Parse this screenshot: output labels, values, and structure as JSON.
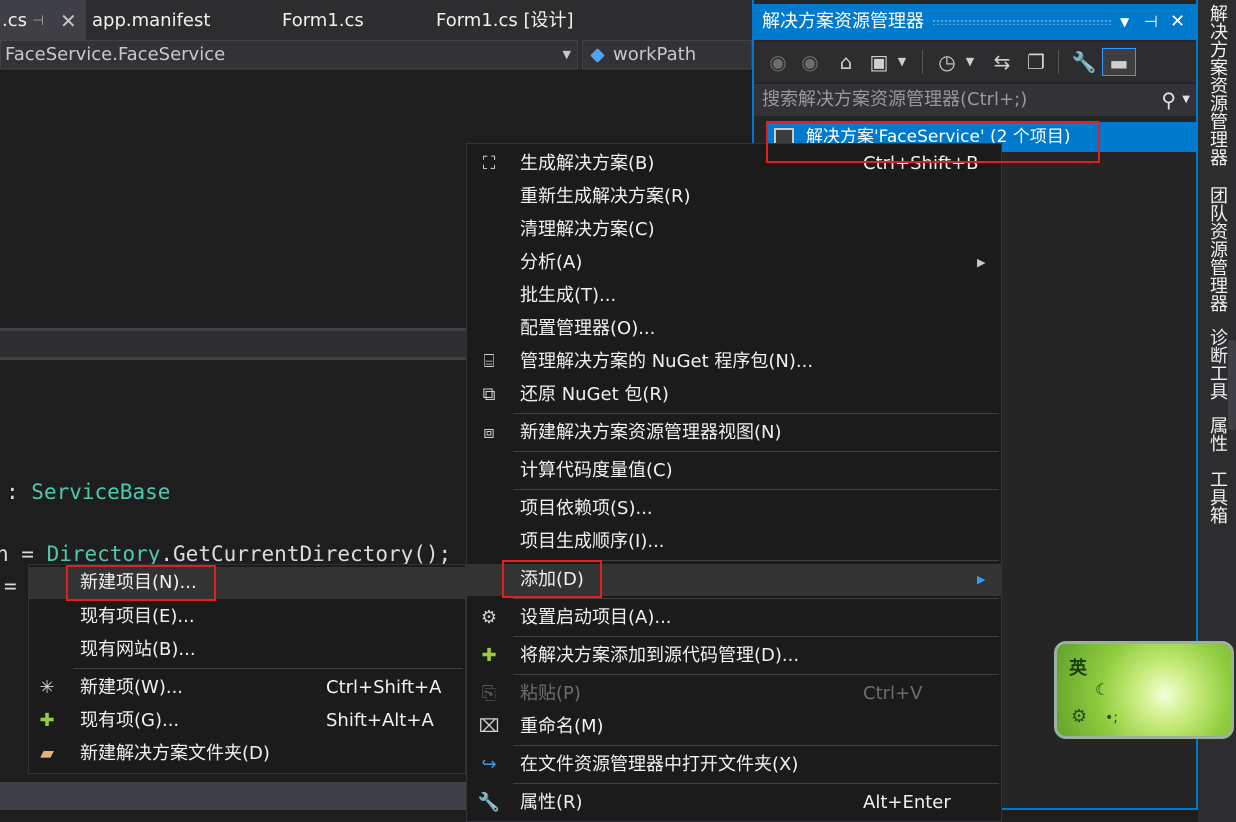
{
  "editor_tabs": [
    {
      "label": ".cs",
      "pin": "⊣",
      "close": "✕"
    },
    {
      "label": "app.manifest"
    },
    {
      "label": "Form1.cs"
    },
    {
      "label": "Form1.cs [设计]"
    }
  ],
  "navbar": {
    "class_combo": "FaceService.FaceService",
    "member_combo": "workPath"
  },
  "code": {
    "line1_sep": ": ",
    "line1_type": "ServiceBase",
    "line2_var": "h",
    "line2_eq": " = ",
    "line2_type": "Directory",
    "line2_rest": ".GetCurrentDirectory();",
    "line3_eq": "="
  },
  "solution_explorer": {
    "title": "解决方案资源管理器",
    "search_placeholder": "搜索解决方案资源管理器(Ctrl+;)",
    "solution_row": "解决方案'FaceService' (2 个项目)"
  },
  "side_tabs": [
    "解决方案资源管理器",
    "团队资源管理器",
    "诊断工具",
    "属性",
    "工具箱"
  ],
  "context_menu": {
    "items": [
      {
        "label": "生成解决方案(B)",
        "shortcut": "Ctrl+Shift+B",
        "icon": "build-icon"
      },
      {
        "label": "重新生成解决方案(R)"
      },
      {
        "label": "清理解决方案(C)"
      },
      {
        "label": "分析(A)",
        "has_submenu": true
      },
      {
        "label": "批生成(T)..."
      },
      {
        "label": "配置管理器(O)..."
      },
      {
        "label": "管理解决方案的 NuGet 程序包(N)...",
        "icon": "nuget-icon"
      },
      {
        "label": "还原 NuGet 包(R)",
        "icon": "restore-icon"
      },
      {
        "label": "新建解决方案资源管理器视图(N)",
        "icon": "new-view-icon"
      },
      {
        "label": "计算代码度量值(C)"
      },
      {
        "label": "项目依赖项(S)..."
      },
      {
        "label": "项目生成顺序(I)..."
      },
      {
        "label": "添加(D)",
        "has_submenu": true
      },
      {
        "label": "设置启动项目(A)...",
        "icon": "gear-icon"
      },
      {
        "label": "将解决方案添加到源代码管理(D)...",
        "icon": "source-control-icon"
      },
      {
        "label": "粘贴(P)",
        "shortcut": "Ctrl+V",
        "icon": "paste-icon",
        "disabled": true
      },
      {
        "label": "重命名(M)",
        "icon": "rename-icon"
      },
      {
        "label": "在文件资源管理器中打开文件夹(X)",
        "icon": "open-folder-icon"
      },
      {
        "label": "属性(R)",
        "shortcut": "Alt+Enter",
        "icon": "wrench-icon"
      }
    ]
  },
  "add_submenu": {
    "items": [
      {
        "label": "新建项目(N)..."
      },
      {
        "label": "现有项目(E)..."
      },
      {
        "label": "现有网站(B)..."
      },
      {
        "label": "新建项(W)...",
        "shortcut": "Ctrl+Shift+A",
        "icon": "new-item-icon"
      },
      {
        "label": "现有项(G)...",
        "shortcut": "Shift+Alt+A",
        "icon": "existing-item-icon"
      },
      {
        "label": "新建解决方案文件夹(D)",
        "icon": "new-folder-icon"
      }
    ]
  },
  "ime": {
    "mode": "英"
  },
  "colors": {
    "accent": "#007acc",
    "highlight_box": "#e02020",
    "type_name": "#4ec9b0"
  }
}
